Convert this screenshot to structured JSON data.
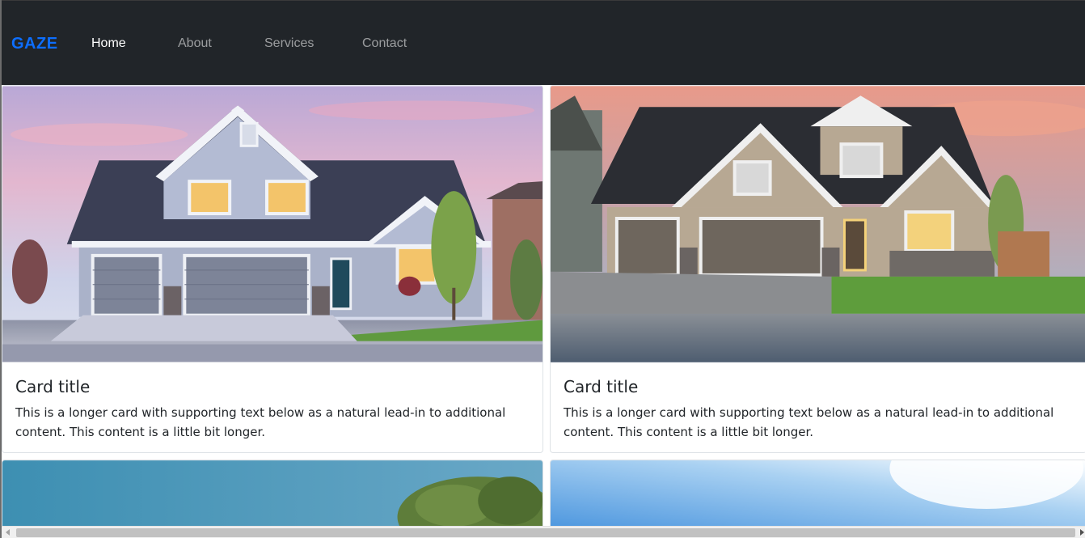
{
  "navbar": {
    "brand": "GAZE",
    "links": [
      {
        "label": "Home",
        "active": true
      },
      {
        "label": "About",
        "active": false
      },
      {
        "label": "Services",
        "active": false
      },
      {
        "label": "Contact",
        "active": false
      }
    ]
  },
  "cards": [
    {
      "title": "Card title",
      "text": "This is a longer card with supporting text below as a natural lead-in to additional content. This content is a little bit longer.",
      "image": "house-photo-blue-siding"
    },
    {
      "title": "Card title",
      "text": "This is a longer card with supporting text below as a natural lead-in to additional content. This content is a little bit longer.",
      "image": "house-photo-beige-siding"
    },
    {
      "image": "sky-with-tree-photo"
    },
    {
      "image": "blue-sky-photo"
    }
  ],
  "colors": {
    "navbar_bg": "#212529",
    "brand": "#0d6efd",
    "nav_active": "#ffffff",
    "nav_inactive": "#8c8e91"
  }
}
